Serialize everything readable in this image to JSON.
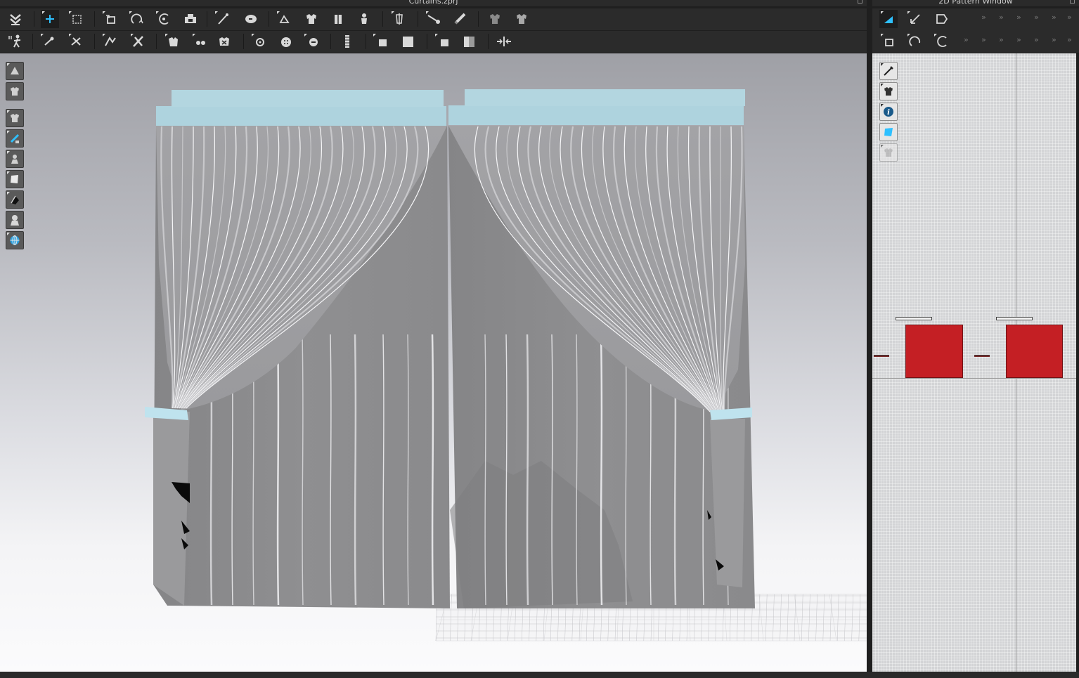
{
  "windows": {
    "main_title": "Curtains.zprj",
    "pattern_title": "2D Pattern Window"
  },
  "toolbar_3d_row1": [
    "simulation",
    "select-move",
    "select-box",
    "transform-pattern",
    "fold-arrangement",
    "rotate-pattern",
    "arrangement",
    "segment-sewing",
    "free-sewing",
    "edit-sewing",
    "avatar-garment",
    "fold",
    "puckering",
    "pin",
    "measure-tape",
    "line-length",
    "tape-measure",
    "shirring",
    "hide-garment",
    "show-garment"
  ],
  "toolbar_3d_row2": [
    "avatar-pose",
    "pin-tool",
    "edit-pin",
    "smoothing",
    "edit-curvature",
    "button",
    "buttonhole",
    "hook",
    "trim",
    "select-trim",
    "zipper",
    "puckering-elastic",
    "fabric-solid",
    "stretch",
    "fabric-flat",
    "unfold"
  ],
  "toolbar_2d": [
    "edit-pattern",
    "transform-pattern-2d",
    "create-rectangle"
  ],
  "viewport": {
    "sidebar_icons": [
      "show-avatar",
      "show-garment",
      "show-3d-pen",
      "show-pattern-outline",
      "show-avatar-mesh",
      "show-texture",
      "show-silhouette",
      "show-environment"
    ],
    "colors": {
      "fabric": "#8f8f91",
      "fabric_highlight": "#ececee",
      "rod": "#a9d2dc",
      "tieback": "#bfe3ee",
      "grid": "#b8b8bc"
    }
  },
  "pattern_window": {
    "sidebar_icons": [
      "pen-tool",
      "garment-tool",
      "info-tool",
      "texture-tool",
      "lock-tool"
    ],
    "panel_color": "#c41f24",
    "panels": [
      "left-curtain-pattern",
      "right-curtain-pattern"
    ]
  }
}
